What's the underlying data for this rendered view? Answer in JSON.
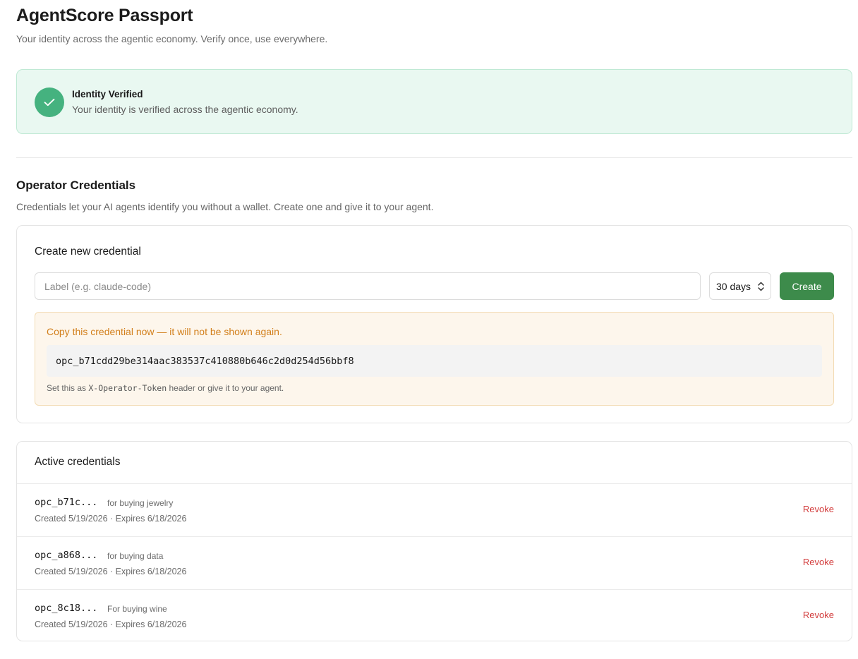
{
  "header": {
    "title": "AgentScore Passport",
    "subtitle": "Your identity across the agentic economy. Verify once, use everywhere."
  },
  "verification": {
    "title": "Identity Verified",
    "description": "Your identity is verified across the agentic economy.",
    "icon": "check-icon",
    "color": "#45b27f"
  },
  "operator": {
    "title": "Operator Credentials",
    "description": "Credentials let your AI agents identify you without a wallet. Create one and give it to your agent."
  },
  "create": {
    "title": "Create new credential",
    "label_placeholder": "Label (e.g. claude-code)",
    "label_value": "",
    "duration_value": "30 days",
    "button_label": "Create",
    "button_color": "#3d8b4b"
  },
  "new_credential": {
    "warning": "Copy this credential now — it will not be shown again.",
    "token": "opc_b71cdd29be314aac383537c410880b646c2d0d254d56bbf8",
    "hint_prefix": "Set this as ",
    "hint_code": "X-Operator-Token",
    "hint_suffix": " header or give it to your agent."
  },
  "active": {
    "title": "Active credentials",
    "revoke_label": "Revoke",
    "items": [
      {
        "id": "opc_b71c...",
        "label": "for buying jewelry",
        "meta": "Created 5/19/2026 · Expires 6/18/2026",
        "revoke": "Revoke"
      },
      {
        "id": "opc_a868...",
        "label": "for buying data",
        "meta": "Created 5/19/2026 · Expires 6/18/2026",
        "revoke": "Revoke"
      },
      {
        "id": "opc_8c18...",
        "label": "For buying wine",
        "meta": "Created 5/19/2026 · Expires 6/18/2026",
        "revoke": "Revoke"
      }
    ]
  }
}
